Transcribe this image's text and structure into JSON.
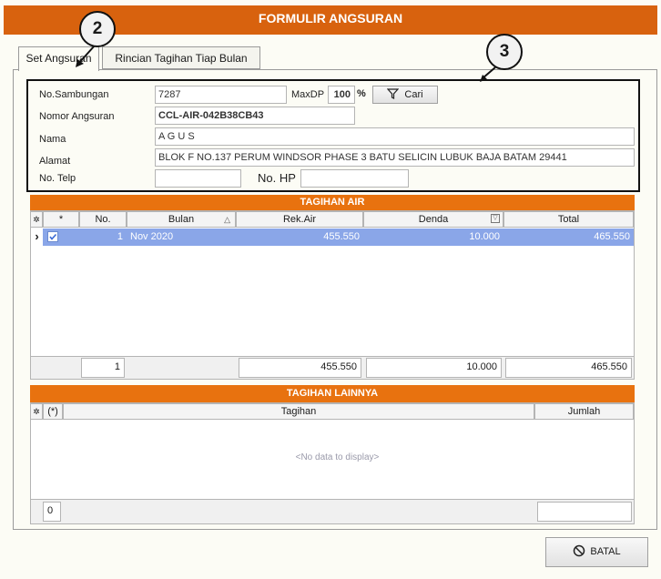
{
  "window": {
    "title": "FORMULIR ANGSURAN"
  },
  "tabs": {
    "set_angsuran": "Set Angsuran",
    "rincian": "Rincian Tagihan Tiap Bulan"
  },
  "callouts": {
    "c2": "2",
    "c3": "3"
  },
  "form": {
    "no_sambungan_label": "No.Sambungan",
    "no_sambungan_value": "7287",
    "maxdp_label": "MaxDP",
    "maxdp_value": "100",
    "maxdp_unit": "%",
    "cari_label": "Cari",
    "nomor_angsuran_label": "Nomor Angsuran",
    "nomor_angsuran_value": "CCL-AIR-042B38CB43",
    "nama_label": "Nama",
    "nama_value": "A G U S",
    "alamat_label": "Alamat",
    "alamat_value": "BLOK F NO.137 PERUM WINDSOR PHASE 3 BATU SELICIN LUBUK BAJA BATAM 29441",
    "no_telp_label": "No. Telp",
    "no_telp_value": "",
    "no_hp_label": "No. HP",
    "no_hp_value": ""
  },
  "tagihan_air": {
    "title": "TAGIHAN AIR",
    "columns": {
      "star": "*",
      "no": "No.",
      "bulan": "Bulan",
      "rek_air": "Rek.Air",
      "denda": "Denda",
      "total": "Total"
    },
    "rows": [
      {
        "no": "1",
        "bulan": "Nov 2020",
        "rek_air": "455.550",
        "denda": "10.000",
        "total": "465.550",
        "checked": true
      }
    ],
    "footer": {
      "count": "1",
      "rek_air": "455.550",
      "denda": "10.000",
      "total": "465.550"
    }
  },
  "tagihan_lainnya": {
    "title": "TAGIHAN LAINNYA",
    "columns": {
      "star": "(*)",
      "tagihan": "Tagihan",
      "jumlah": "Jumlah"
    },
    "empty_text": "<No data to display>",
    "footer": {
      "count": "0",
      "jumlah": ""
    }
  },
  "actions": {
    "batal_label": "BATAL"
  },
  "colors": {
    "accent": "#d8620e",
    "selection": "#8aa6e8"
  },
  "icons": {
    "filter": "filter-icon",
    "cancel": "ban-icon"
  }
}
